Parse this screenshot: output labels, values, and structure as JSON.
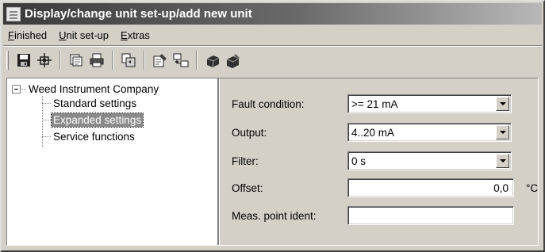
{
  "window": {
    "title": "Display/change unit set-up/add new unit"
  },
  "menu": [
    "Finished",
    "Unit set-up",
    "Extras"
  ],
  "toolbar": {
    "icons": [
      "save-icon",
      "scan-icon",
      "print-preview-icon",
      "print-icon",
      "copy-icon",
      "properties-icon",
      "network-icon",
      "device-read-icon",
      "device-write-icon"
    ]
  },
  "tree": {
    "root": "Weed Instrument Company",
    "children": [
      "Standard settings",
      "Expanded settings",
      "Service functions"
    ],
    "selected": "Expanded settings"
  },
  "form": {
    "fault_condition": {
      "label": "Fault condition:",
      "value": ">= 21 mA"
    },
    "output": {
      "label": "Output:",
      "value": "4..20 mA"
    },
    "filter": {
      "label": "Filter:",
      "value": "0 s"
    },
    "offset": {
      "label": "Offset:",
      "value": "0,0",
      "unit": "°C"
    },
    "meas_point_ident": {
      "label": "Meas. point ident:",
      "value": ""
    }
  }
}
